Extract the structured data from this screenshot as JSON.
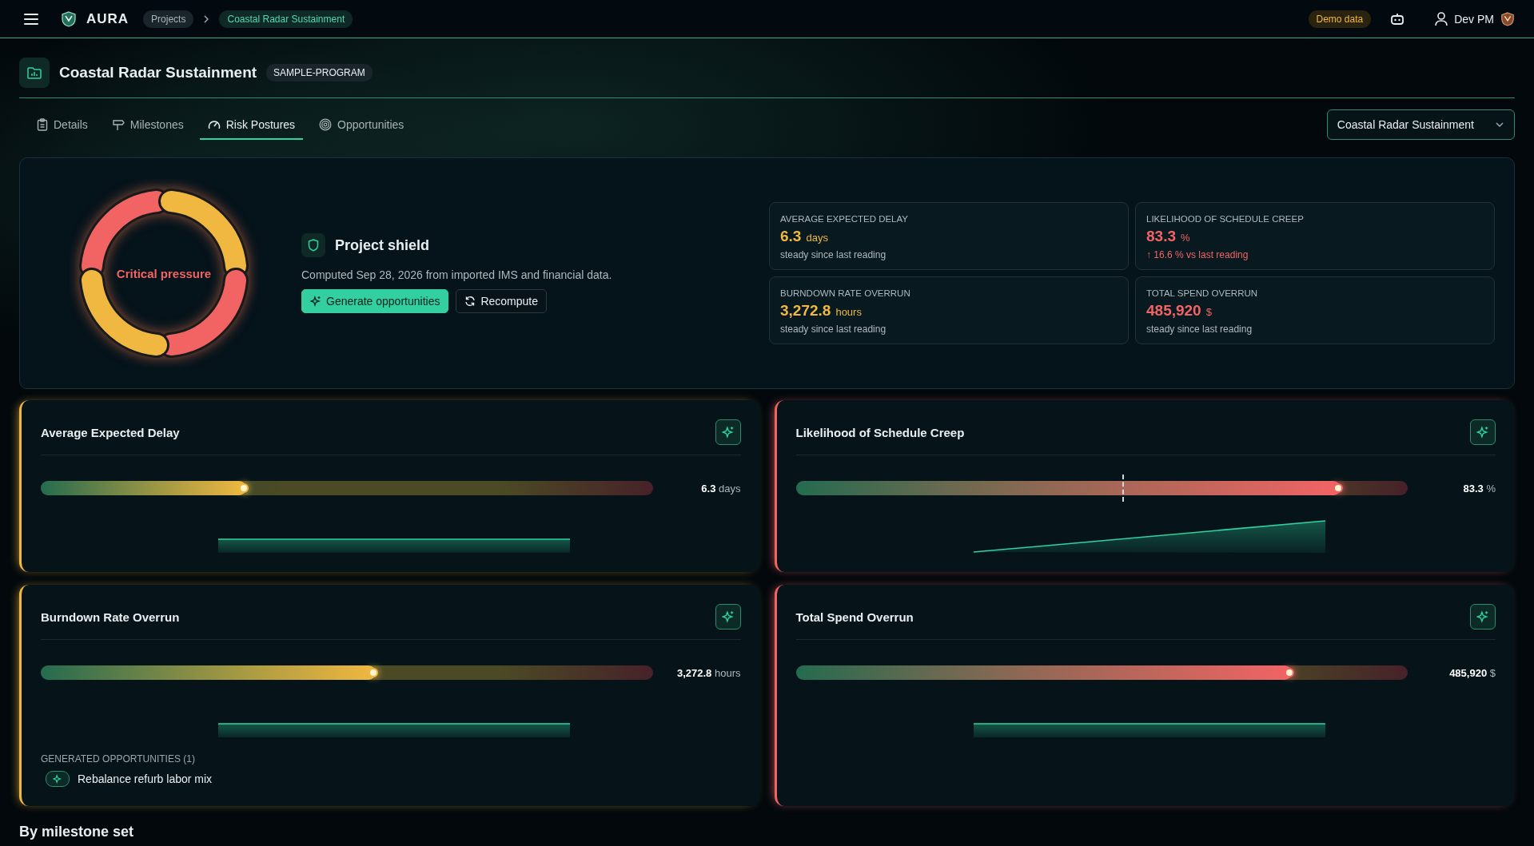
{
  "topbar": {
    "brand": "AURA",
    "breadcrumbs": [
      {
        "label": "Projects",
        "selected": false
      },
      {
        "label": "Coastal Radar Sustainment",
        "selected": true
      }
    ],
    "badge": "Demo data",
    "user": "Dev PM"
  },
  "project": {
    "title": "Coastal Radar Sustainment",
    "tag": "SAMPLE-PROGRAM"
  },
  "tabs": [
    {
      "label": "Details",
      "selected": false
    },
    {
      "label": "Milestones",
      "selected": false
    },
    {
      "label": "Risk Postures",
      "selected": true
    },
    {
      "label": "Opportunities",
      "selected": false
    }
  ],
  "project_select": {
    "value": "Coastal Radar Sustainment"
  },
  "summary": {
    "status": {
      "label": "Critical pressure",
      "color": "#f26464"
    },
    "title": "Project shield",
    "subtitle": "Computed Sep 28, 2026 from imported IMS and financial data.",
    "buttons": [
      {
        "label": "Generate opportunities",
        "kind": "primary"
      },
      {
        "label": "Recompute",
        "kind": "secondary"
      }
    ],
    "metrics": [
      {
        "label": "AVERAGE EXPECTED DELAY",
        "value": "6.3",
        "unit": "days",
        "note": "steady since last reading",
        "color": "#f0b840"
      },
      {
        "label": "LIKELIHOOD OF SCHEDULE CREEP",
        "value": "83.3",
        "unit": "%",
        "change": "↑ 16.6 % vs last reading",
        "color": "#f26464"
      },
      {
        "label": "BURNDOWN RATE OVERRUN",
        "value": "3,272.8",
        "unit": "hours",
        "note": "steady since last reading",
        "color": "#f0b840"
      },
      {
        "label": "TOTAL SPEND OVERRUN",
        "value": "485,920",
        "unit": "$",
        "note": "steady since last reading",
        "color": "#f26464"
      }
    ]
  },
  "cards": [
    {
      "title": "Average Expected Delay",
      "color": "#f0b840",
      "level": 0.336,
      "value": "6.3",
      "unit": "days",
      "kind": "flat"
    },
    {
      "title": "Likelihood of Schedule Creep",
      "color": "#f26464",
      "level": 0.89,
      "previous": {
        "level": 0.533
      },
      "value": "83.3",
      "unit": "%",
      "kind": "rising"
    },
    {
      "title": "Burndown Rate Overrun",
      "color": "#f0b840",
      "level": 0.547,
      "value": "3,272.8",
      "unit": "hours",
      "kind": "flat",
      "opportunities": {
        "heading": "GENERATED OPPORTUNITIES (1)",
        "items": [
          "Rebalance refurb labor mix"
        ]
      }
    },
    {
      "title": "Total Spend Overrun",
      "color": "#f26464",
      "level": 0.81,
      "value": "485,920",
      "unit": "$",
      "kind": "flat"
    }
  ],
  "section_heading": "By milestone set"
}
